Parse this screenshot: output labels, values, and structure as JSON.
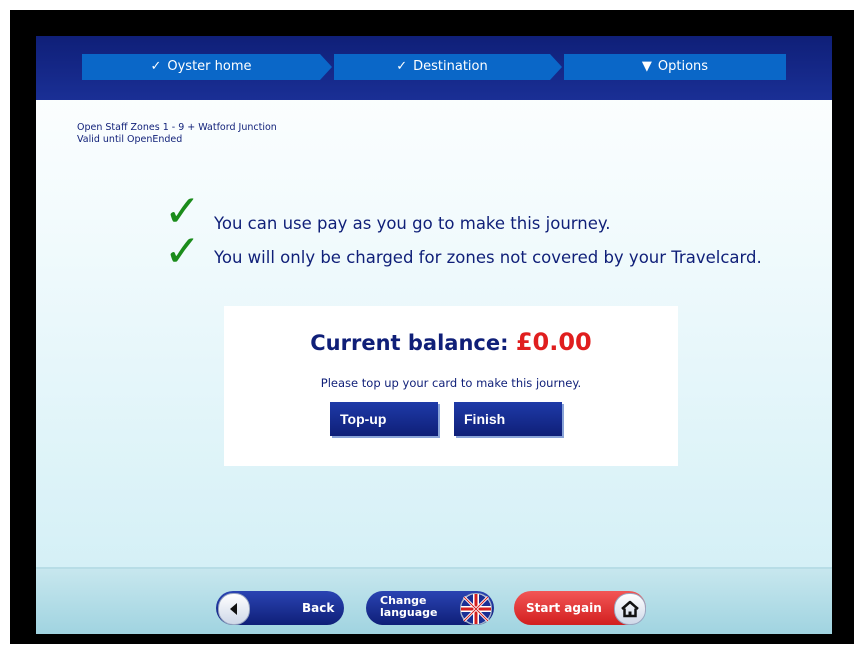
{
  "steps": [
    {
      "label": "Oyster home",
      "mark": "✓"
    },
    {
      "label": "Destination",
      "mark": "✓"
    },
    {
      "label": "Options",
      "mark": "▼"
    }
  ],
  "ticket": {
    "line1": "Open Staff Zones 1 - 9 + Watford Junction",
    "line2": "Valid until OpenEnded"
  },
  "messages": [
    "You can use pay as you go to make this journey.",
    "You will only be charged for zones not covered by your Travelcard."
  ],
  "balance": {
    "label": "Current balance:",
    "amount": "£0.00",
    "note": "Please top up your card to make this journey."
  },
  "buttons": {
    "topup": "Top-up",
    "finish": "Finish"
  },
  "footer": {
    "back": "Back",
    "change_language_line1": "Change",
    "change_language_line2": "language",
    "start_again": "Start again"
  },
  "colors": {
    "navy": "#0f1f78",
    "step_blue": "#0a67c8",
    "tick_green": "#1b8c1b",
    "alert_red": "#e01e1e",
    "start_red": "#d21f1f"
  },
  "icons": {
    "back": "left-arrow-icon",
    "language": "uk-flag-icon",
    "start_again": "home-icon"
  }
}
